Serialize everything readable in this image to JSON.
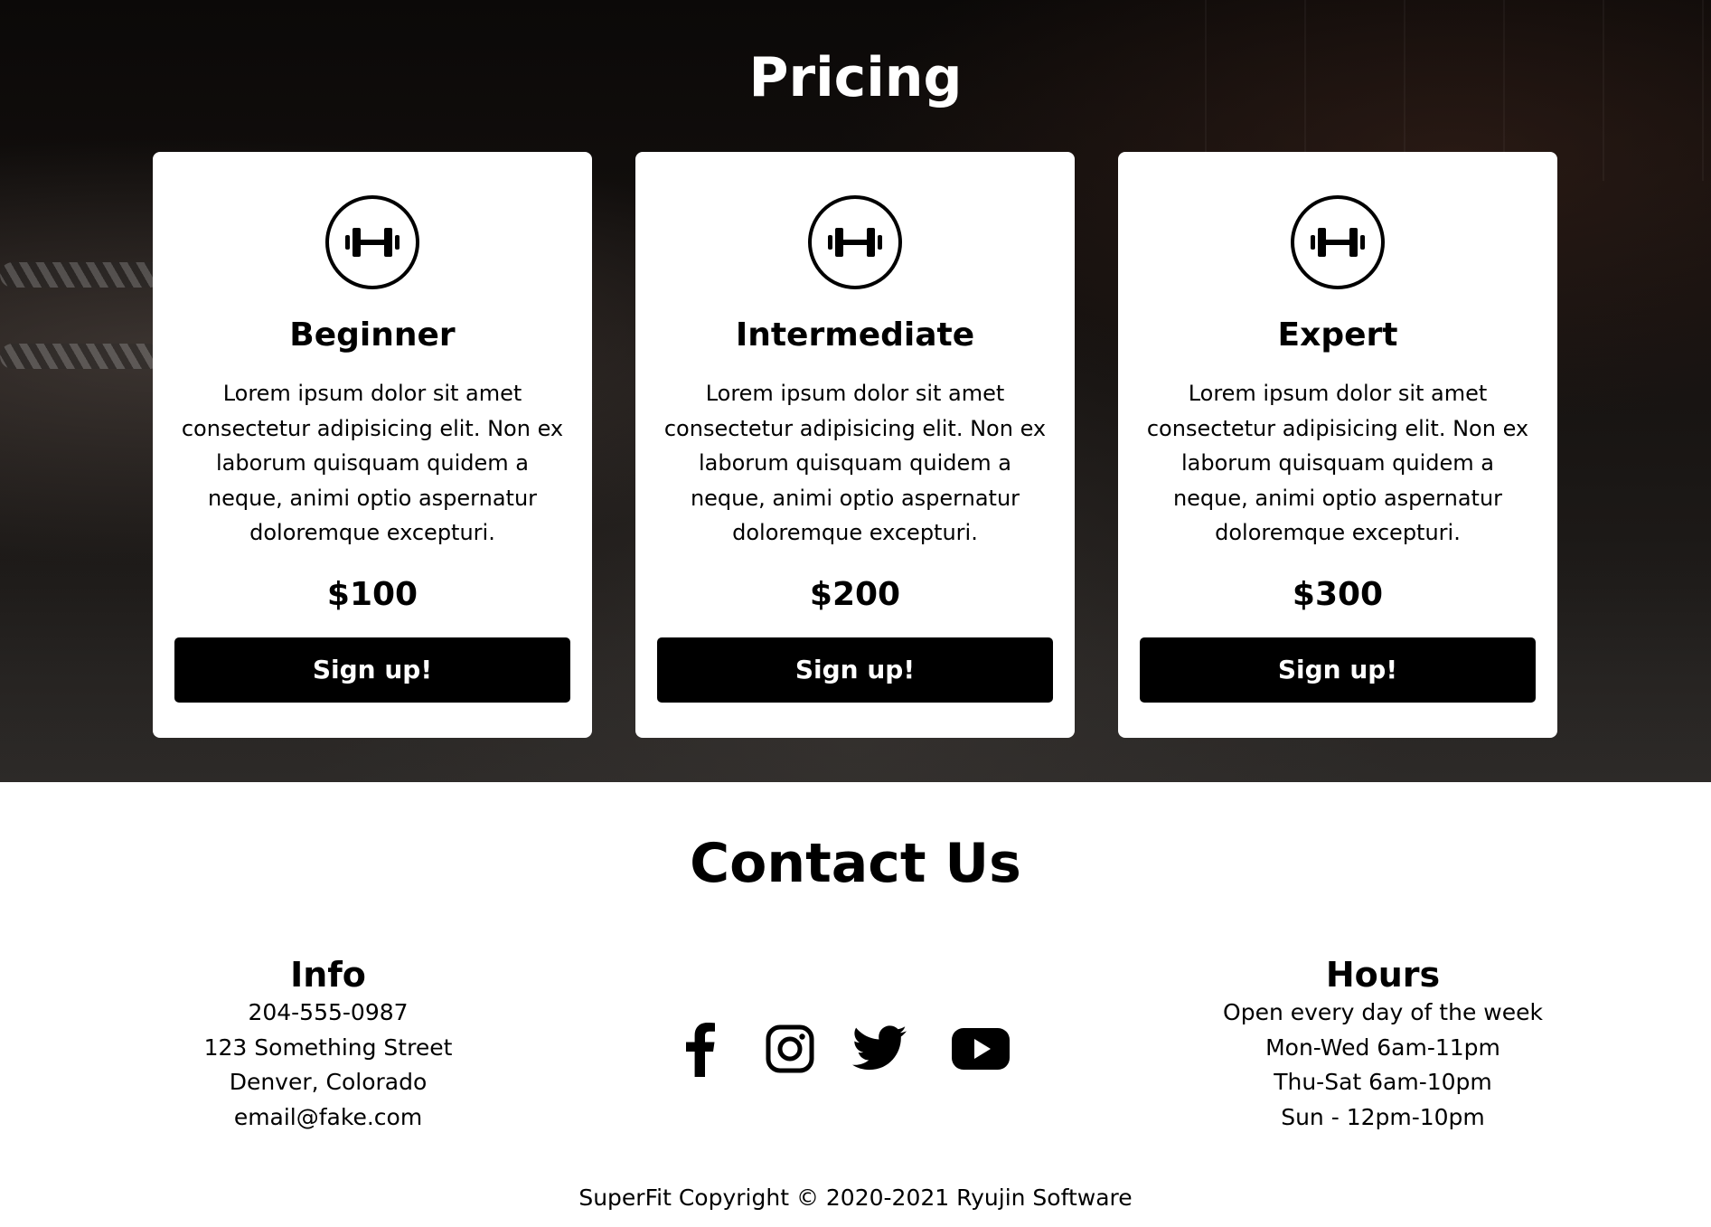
{
  "pricing": {
    "title": "Pricing",
    "plans": [
      {
        "icon": "dumbbell-icon",
        "name": "Beginner",
        "description": "Lorem ipsum dolor sit amet consectetur adipisicing elit. Non ex laborum quisquam quidem a neque, animi optio aspernatur doloremque excepturi.",
        "price": "$100",
        "button_label": "Sign up!"
      },
      {
        "icon": "dumbbell-icon",
        "name": "Intermediate",
        "description": "Lorem ipsum dolor sit amet consectetur adipisicing elit. Non ex laborum quisquam quidem a neque, animi optio aspernatur doloremque excepturi.",
        "price": "$200",
        "button_label": "Sign up!"
      },
      {
        "icon": "dumbbell-icon",
        "name": "Expert",
        "description": "Lorem ipsum dolor sit amet consectetur adipisicing elit. Non ex laborum quisquam quidem a neque, animi optio aspernatur doloremque excepturi.",
        "price": "$300",
        "button_label": "Sign up!"
      }
    ]
  },
  "contact": {
    "title": "Contact Us",
    "info": {
      "title": "Info",
      "lines": [
        "204-555-0987",
        "123 Something Street",
        "Denver, Colorado",
        "email@fake.com"
      ]
    },
    "socials": [
      "facebook-icon",
      "instagram-icon",
      "twitter-icon",
      "youtube-icon"
    ],
    "hours": {
      "title": "Hours",
      "lines": [
        "Open every day of the week",
        "Mon-Wed 6am-11pm",
        "Thu-Sat 6am-10pm",
        "Sun - 12pm-10pm"
      ]
    }
  },
  "footer": {
    "copyright": "SuperFit Copyright © 2020-2021 Ryujin Software"
  },
  "colors": {
    "card_bg": "#ffffff",
    "button_bg": "#000000",
    "button_text": "#ffffff",
    "pricing_bg": "#141110"
  }
}
